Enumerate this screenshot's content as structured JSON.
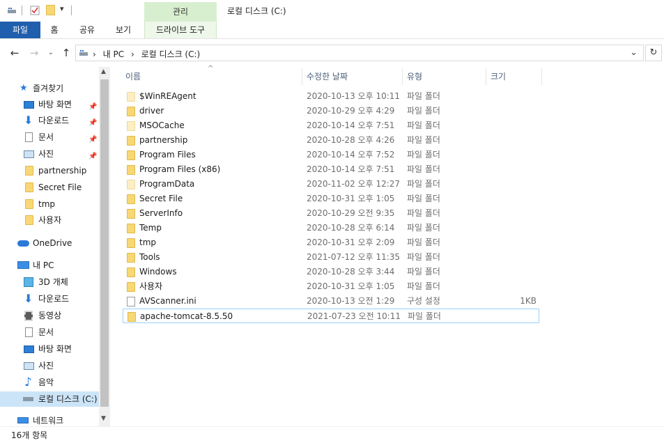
{
  "window": {
    "title": "로컬 디스크 (C:)",
    "manage_tab": "관리"
  },
  "ribbon": {
    "tabs": [
      "파일",
      "홈",
      "공유",
      "보기",
      "드라이브 도구"
    ]
  },
  "address": {
    "crumbs": [
      "내 PC",
      "로컬 디스크 (C:)"
    ],
    "sep": "›"
  },
  "nav": {
    "quick_access": "즐겨찾기",
    "pinned": [
      {
        "label": "바탕 화면"
      },
      {
        "label": "다운로드"
      },
      {
        "label": "문서"
      },
      {
        "label": "사진"
      }
    ],
    "folders": [
      {
        "label": "partnership"
      },
      {
        "label": "Secret File"
      },
      {
        "label": "tmp"
      },
      {
        "label": "사용자"
      }
    ],
    "onedrive": "OneDrive",
    "this_pc": "내 PC",
    "pc_items": [
      {
        "label": "3D 개체"
      },
      {
        "label": "다운로드"
      },
      {
        "label": "동영상"
      },
      {
        "label": "문서"
      },
      {
        "label": "바탕 화면"
      },
      {
        "label": "사진"
      },
      {
        "label": "음악"
      },
      {
        "label": "로컬 디스크 (C:)"
      }
    ],
    "network": "네트워크"
  },
  "columns": {
    "name": "이름",
    "date": "수정한 날짜",
    "type": "유형",
    "size": "크기"
  },
  "files": [
    {
      "name": "$WinREAgent",
      "date": "2020-10-13 오후 10:11",
      "type": "파일 폴더",
      "size": "",
      "kind": "folder-light"
    },
    {
      "name": "driver",
      "date": "2020-10-29 오후 4:29",
      "type": "파일 폴더",
      "size": "",
      "kind": "folder"
    },
    {
      "name": "MSOCache",
      "date": "2020-10-14 오후 7:51",
      "type": "파일 폴더",
      "size": "",
      "kind": "folder-light"
    },
    {
      "name": "partnership",
      "date": "2020-10-28 오후 4:26",
      "type": "파일 폴더",
      "size": "",
      "kind": "folder"
    },
    {
      "name": "Program Files",
      "date": "2020-10-14 오후 7:52",
      "type": "파일 폴더",
      "size": "",
      "kind": "folder"
    },
    {
      "name": "Program Files (x86)",
      "date": "2020-10-14 오후 7:51",
      "type": "파일 폴더",
      "size": "",
      "kind": "folder"
    },
    {
      "name": "ProgramData",
      "date": "2020-11-02 오후 12:27",
      "type": "파일 폴더",
      "size": "",
      "kind": "folder-light"
    },
    {
      "name": "Secret File",
      "date": "2020-10-31 오후 1:05",
      "type": "파일 폴더",
      "size": "",
      "kind": "folder"
    },
    {
      "name": "ServerInfo",
      "date": "2020-10-29 오전 9:35",
      "type": "파일 폴더",
      "size": "",
      "kind": "folder"
    },
    {
      "name": "Temp",
      "date": "2020-10-28 오후 6:14",
      "type": "파일 폴더",
      "size": "",
      "kind": "folder"
    },
    {
      "name": "tmp",
      "date": "2020-10-31 오후 2:09",
      "type": "파일 폴더",
      "size": "",
      "kind": "folder"
    },
    {
      "name": "Tools",
      "date": "2021-07-12 오후 11:35",
      "type": "파일 폴더",
      "size": "",
      "kind": "folder"
    },
    {
      "name": "Windows",
      "date": "2020-10-28 오후 3:44",
      "type": "파일 폴더",
      "size": "",
      "kind": "folder"
    },
    {
      "name": "사용자",
      "date": "2020-10-31 오후 1:05",
      "type": "파일 폴더",
      "size": "",
      "kind": "folder"
    },
    {
      "name": "AVScanner.ini",
      "date": "2020-10-13 오전 1:29",
      "type": "구성 설정",
      "size": "1KB",
      "kind": "file"
    },
    {
      "name": "apache-tomcat-8.5.50",
      "date": "2021-07-23 오전 10:11",
      "type": "파일 폴더",
      "size": "",
      "kind": "folder"
    }
  ],
  "status": {
    "count": "16개 항목"
  }
}
